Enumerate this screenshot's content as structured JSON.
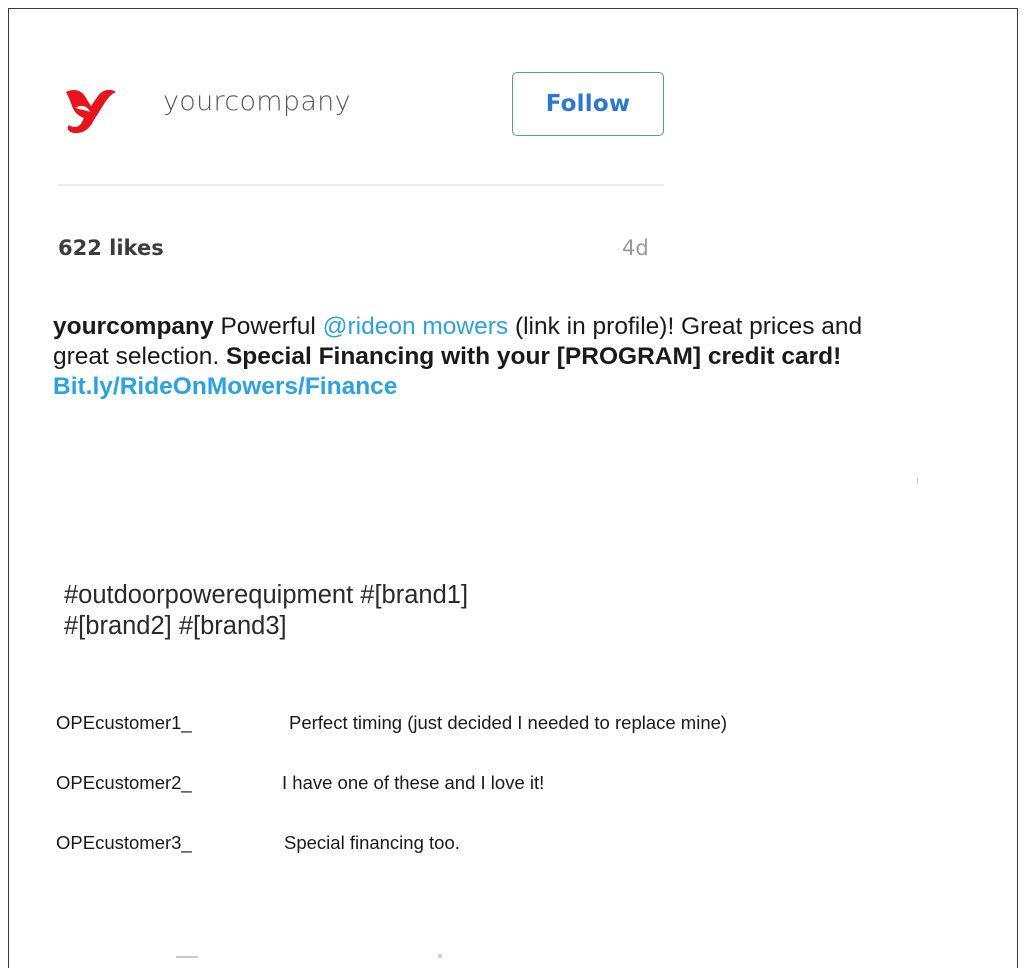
{
  "post": {
    "username": "yourcompany",
    "follow_label": "Follow",
    "likes": "622 likes",
    "time_ago": "4d"
  },
  "caption": {
    "username": "yourcompany",
    "text_1": " Powerful ",
    "mention": "@rideon mowers",
    "text_2": " (link in profile)! Great prices and great selection. ",
    "bold_text": "Special Financing with your [PROGRAM] credit card!",
    "link": "Bit.ly/RideOnMowers/Finance"
  },
  "hashtags": {
    "line_1": "#outdoorpowerequipment  #[brand1]",
    "line_2": "#[brand2]  #[brand3]"
  },
  "comments": [
    {
      "user": "OPEcustomer1_",
      "text": "Perfect timing (just decided I needed to replace mine)"
    },
    {
      "user": "OPEcustomer2_",
      "text": "I have one of these and I love it!"
    },
    {
      "user": "OPEcustomer3_",
      "text": "Special financing too."
    }
  ],
  "colors": {
    "logo": "#e8141b",
    "follow_border": "#4c94e0",
    "follow_text": "#2a78d4",
    "mention": "#29a3e3"
  },
  "icons": {
    "logo": "brand-logo-icon"
  }
}
